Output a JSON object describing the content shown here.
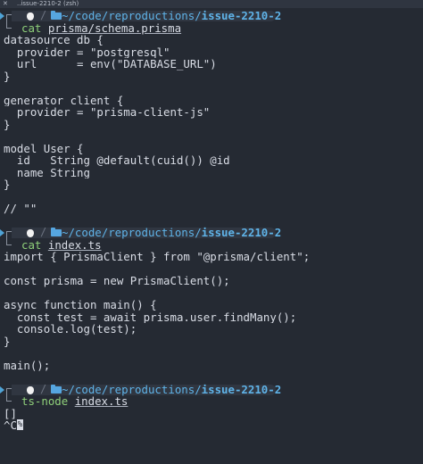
{
  "window": {
    "tab_title": "..issue-2210-2 (zsh)",
    "close_glyph": "✕"
  },
  "prompts": [
    {
      "path_prefix": "~/code/reproductions/",
      "path_leaf": "issue-2210-2",
      "command": "cat",
      "argument": "prisma/schema.prisma"
    },
    {
      "path_prefix": "~/code/reproductions/",
      "path_leaf": "issue-2210-2",
      "command": "cat",
      "argument": "index.ts"
    },
    {
      "path_prefix": "~/code/reproductions/",
      "path_leaf": "issue-2210-2",
      "command": "ts-node",
      "argument": "index.ts"
    }
  ],
  "outputs": {
    "schema": [
      "datasource db {",
      "  provider = \"postgresql\"",
      "  url      = env(\"DATABASE_URL\")",
      "}",
      "",
      "generator client {",
      "  provider = \"prisma-client-js\"",
      "}",
      "",
      "model User {",
      "  id   String @default(cuid()) @id",
      "  name String",
      "}",
      "",
      "// \"\""
    ],
    "index": [
      "import { PrismaClient } from \"@prisma/client\";",
      "",
      "const prisma = new PrismaClient();",
      "",
      "async function main() {",
      "  const test = await prisma.user.findMany();",
      "  console.log(test);",
      "}",
      "",
      "main();"
    ],
    "run": [
      "[]"
    ],
    "interrupt": "^C",
    "cursor_glyph": "%"
  },
  "icons": {
    "prompt_arrow": "chevron-right-icon",
    "os_logo": "apple-icon",
    "folder": "folder-icon"
  },
  "colors": {
    "background": "#252a33",
    "text": "#d9dde6",
    "path": "#5fb3e8",
    "command": "#8fd07a",
    "prompt_bar": "#303641"
  }
}
